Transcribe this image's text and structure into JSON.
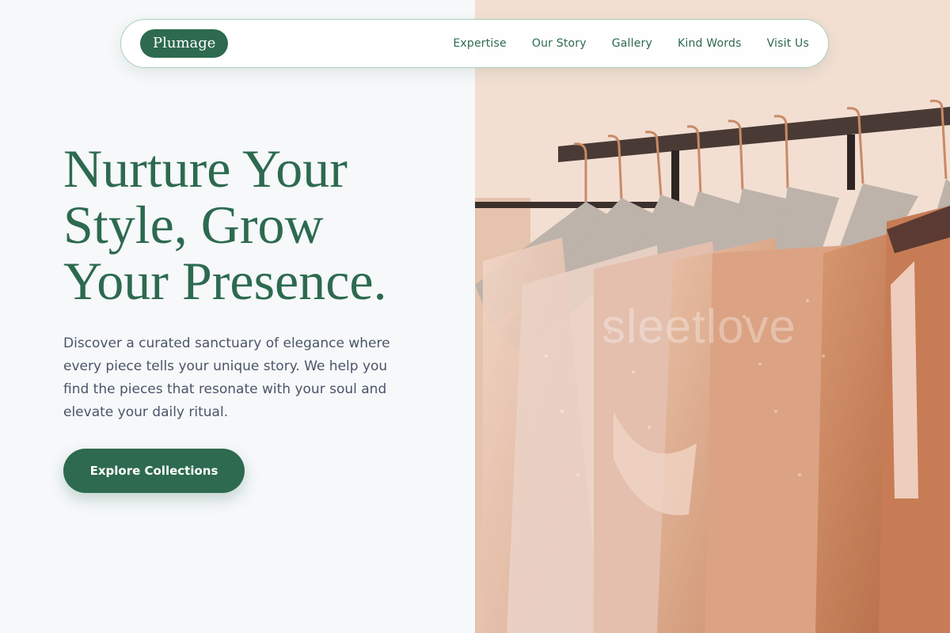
{
  "nav": {
    "brand": "Plumage",
    "links": [
      "Expertise",
      "Our Story",
      "Gallery",
      "Kind Words",
      "Visit Us"
    ]
  },
  "hero": {
    "title_lines": [
      "Nurture Your",
      "Style, Grow",
      "Your Presence."
    ],
    "description": "Discover a curated sanctuary of elegance where every piece tells your unique story. We help you find the pieces that resonate with your soul and elevate your daily ritual.",
    "cta_label": "Explore Collections"
  },
  "image": {
    "watermark": "sleetlove"
  },
  "colors": {
    "accent": "#2d6a4f",
    "background": "#f6f8fa",
    "body_text": "#4a5568",
    "nav_border": "#a9cfb7"
  }
}
